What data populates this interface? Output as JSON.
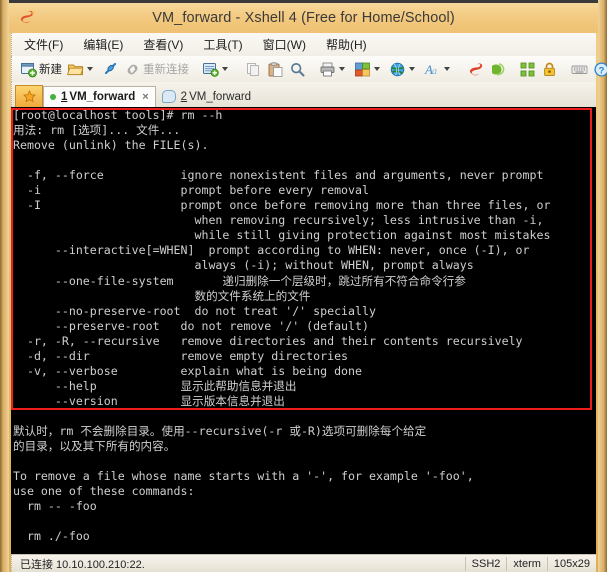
{
  "window": {
    "title": "VM_forward - Xshell 4 (Free for Home/School)",
    "app_icon": "xshell-logo-icon"
  },
  "menubar": {
    "items": [
      {
        "label": "文件(F)",
        "name": "menu-file"
      },
      {
        "label": "编辑(E)",
        "name": "menu-edit"
      },
      {
        "label": "查看(V)",
        "name": "menu-view"
      },
      {
        "label": "工具(T)",
        "name": "menu-tools"
      },
      {
        "label": "窗口(W)",
        "name": "menu-window"
      },
      {
        "label": "帮助(H)",
        "name": "menu-help"
      }
    ]
  },
  "toolbar": {
    "new_label": "新建",
    "reconnect_label": "重新连接",
    "icons": {
      "new_session": "new-session-icon",
      "open_folder": "open-folder-icon",
      "connect": "connect-plug-icon",
      "reconnect": "reconnect-link-icon",
      "session_manager": "session-manager-icon",
      "copy": "copy-icon",
      "paste": "paste-icon",
      "find": "find-magnifier-icon",
      "print": "print-icon",
      "transfer": "file-transfer-icon",
      "globe": "globe-icon",
      "font": "font-icon",
      "xshell": "xshell-red-icon",
      "xftp": "xftp-green-icon",
      "arrange": "arrange-windows-icon",
      "lock": "lock-icon",
      "keyboard": "keyboard-icon",
      "help": "help-icon"
    }
  },
  "tabs": {
    "launcher_icon": "launcher-star-icon",
    "items": [
      {
        "num": "1",
        "label": "VM_forward",
        "active": true,
        "status": "connected",
        "close": "×"
      },
      {
        "num": "2",
        "label": "VM_forward",
        "active": false,
        "status": "idle"
      }
    ]
  },
  "terminal": {
    "highlight_color": "#f01d1d",
    "lines": [
      "[root@localhost tools]# rm --h",
      "用法: rm [选项]... 文件...",
      "Remove (unlink) the FILE(s).",
      "",
      "  -f, --force           ignore nonexistent files and arguments, never prompt",
      "  -i                    prompt before every removal",
      "  -I                    prompt once before removing more than three files, or",
      "                          when removing recursively; less intrusive than -i,",
      "                          while still giving protection against most mistakes",
      "      --interactive[=WHEN]  prompt according to WHEN: never, once (-I), or",
      "                          always (-i); without WHEN, prompt always",
      "      --one-file-system       递归删除一个层级时，跳过所有不符合命令行参",
      "                          数的文件系统上的文件",
      "      --no-preserve-root  do not treat '/' specially",
      "      --preserve-root   do not remove '/' (default)",
      "  -r, -R, --recursive   remove directories and their contents recursively",
      "  -d, --dir             remove empty directories",
      "  -v, --verbose         explain what is being done",
      "      --help            显示此帮助信息并退出",
      "      --version         显示版本信息并退出",
      "",
      "默认时，rm 不会删除目录。使用--recursive(-r 或-R)选项可删除每个给定",
      "的目录，以及其下所有的内容。",
      "",
      "To remove a file whose name starts with a '-', for example '-foo',",
      "use one of these commands:",
      "  rm -- -foo",
      "",
      "  rm ./-foo"
    ]
  },
  "statusbar": {
    "connection": "已连接 10.10.100.210:22.",
    "protocol": "SSH2",
    "emulation": "xterm",
    "size": "105x29"
  }
}
